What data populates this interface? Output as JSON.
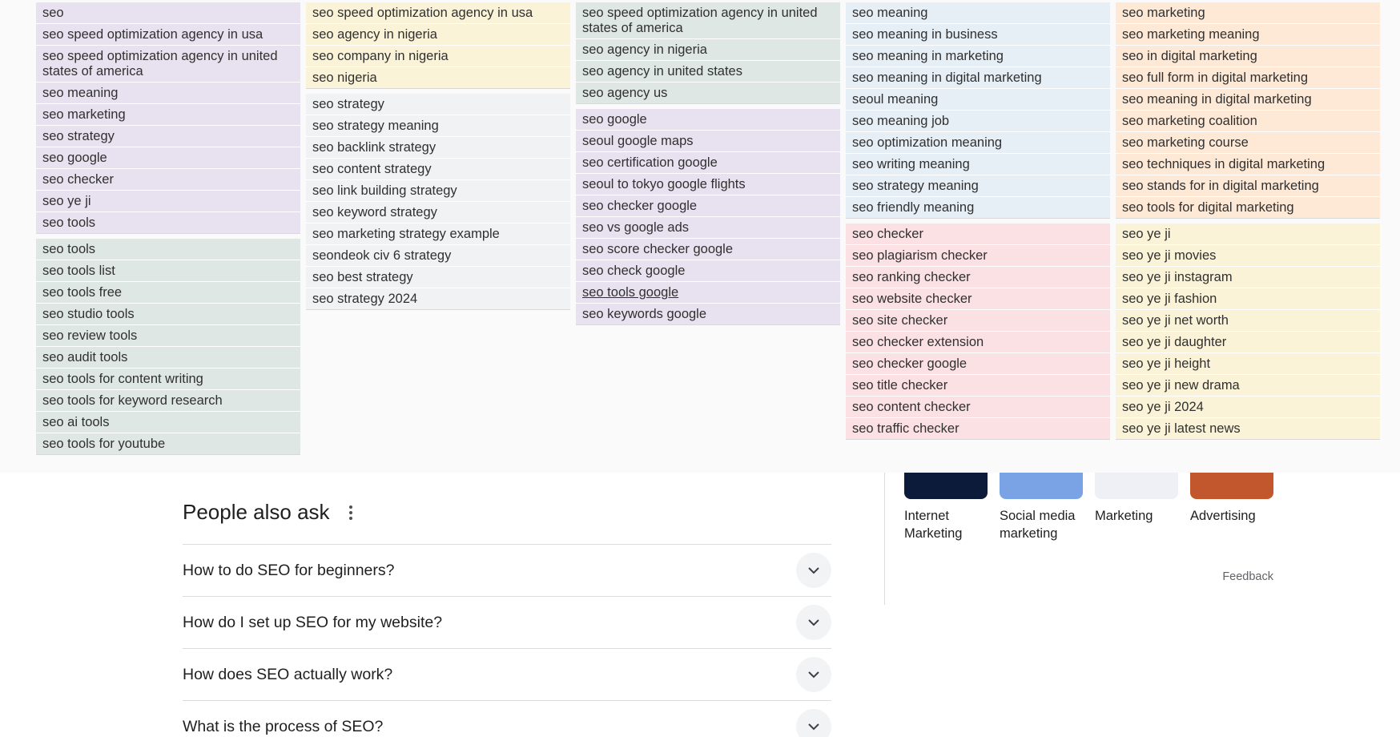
{
  "suggestion_columns": [
    [
      {
        "color": "purple",
        "items": [
          "seo",
          "seo speed optimization agency in usa",
          "seo speed optimization agency in united states of america",
          "seo meaning",
          "seo marketing",
          "seo strategy",
          "seo google",
          "seo checker",
          "seo ye ji",
          "seo tools"
        ]
      },
      {
        "color": "teal",
        "items": [
          "seo tools",
          "seo tools list",
          "seo tools free",
          "seo studio tools",
          "seo review tools",
          "seo audit tools",
          "seo tools for content writing",
          "seo tools for keyword research",
          "seo ai tools",
          "seo tools for youtube"
        ]
      }
    ],
    [
      {
        "color": "yellow",
        "items": [
          "seo speed optimization agency in usa",
          "seo agency in nigeria",
          "seo company in nigeria",
          "seo nigeria"
        ]
      },
      {
        "color": "gray",
        "items": [
          "seo strategy",
          "seo strategy meaning",
          "seo backlink strategy",
          "seo content strategy",
          "seo link building strategy",
          "seo keyword strategy",
          "seo marketing strategy example",
          "seondeok civ 6 strategy",
          "seo best strategy",
          "seo strategy 2024"
        ]
      }
    ],
    [
      {
        "color": "teal",
        "items": [
          "seo speed optimization agency in united states of america",
          "seo agency in nigeria",
          "seo agency in united states",
          "seo agency us"
        ]
      },
      {
        "color": "purple",
        "items": [
          "seo google",
          "seoul google maps",
          "seo certification google",
          "seoul to tokyo google flights",
          "seo checker google",
          "seo vs google ads",
          "seo score checker google",
          "seo check google",
          "seo tools google",
          "seo keywords google"
        ],
        "underlined": "seo tools google"
      }
    ],
    [
      {
        "color": "blue",
        "items": [
          "seo meaning",
          "seo meaning in business",
          "seo meaning in marketing",
          "seo meaning in digital marketing",
          "seoul meaning",
          "seo meaning job",
          "seo optimization meaning",
          "seo writing meaning",
          "seo strategy meaning",
          "seo friendly meaning"
        ]
      },
      {
        "color": "pink",
        "items": [
          "seo checker",
          "seo plagiarism checker",
          "seo ranking checker",
          "seo website checker",
          "seo site checker",
          "seo checker extension",
          "seo checker google",
          "seo title checker",
          "seo content checker",
          "seo traffic checker"
        ]
      }
    ],
    [
      {
        "color": "orange",
        "items": [
          "seo marketing",
          "seo marketing meaning",
          "seo in digital marketing",
          "seo full form in digital marketing",
          "seo meaning in digital marketing",
          "seo marketing coalition",
          "seo marketing course",
          "seo techniques in digital marketing",
          "seo stands for in digital marketing",
          "seo tools for digital marketing"
        ]
      },
      {
        "color": "yellow",
        "items": [
          "seo ye ji",
          "seo ye ji movies",
          "seo ye ji instagram",
          "seo ye ji fashion",
          "seo ye ji net worth",
          "seo ye ji daughter",
          "seo ye ji height",
          "seo ye ji new drama",
          "seo ye ji 2024",
          "seo ye ji latest news"
        ]
      }
    ]
  ],
  "people_also_ask": {
    "title": "People also ask",
    "questions": [
      "How to do SEO for beginners?",
      "How do I set up SEO for my website?",
      "How does SEO actually work?",
      "What is the process of SEO?"
    ]
  },
  "related_topics": [
    {
      "label": "Internet Marketing",
      "color": "#0d1b3a"
    },
    {
      "label": "Social media marketing",
      "color": "#7aa3e6"
    },
    {
      "label": "Marketing",
      "color": "#eef0f5"
    },
    {
      "label": "Advertising",
      "color": "#c2572d"
    }
  ],
  "feedback_label": "Feedback"
}
